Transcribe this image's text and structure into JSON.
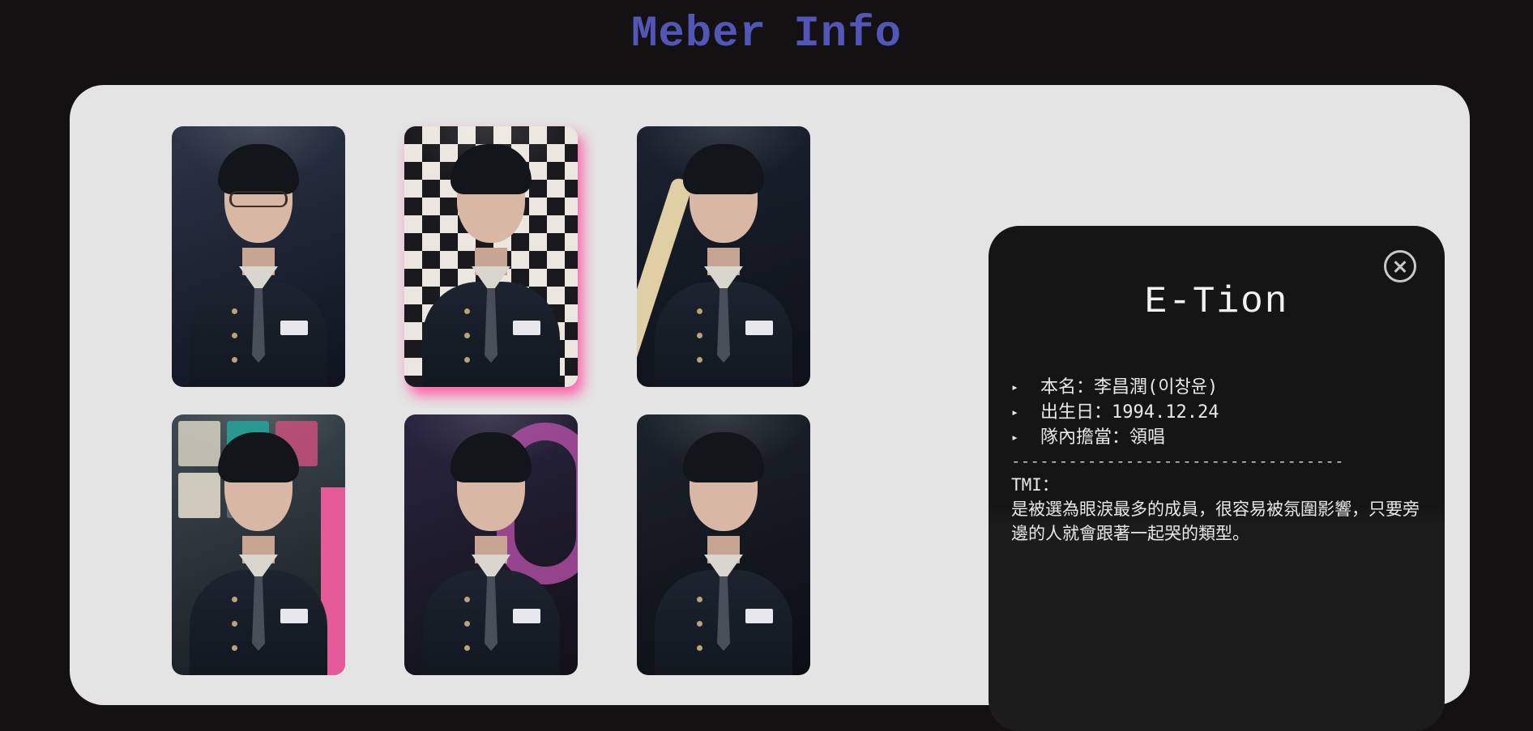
{
  "page": {
    "title": "Meber Info"
  },
  "members": [
    {
      "card_label": "member-photo-1",
      "palette": {
        "bg1": "#2c3446",
        "bg2": "#0f1320",
        "accent": "#7d8aa0"
      },
      "glasses": true
    },
    {
      "card_label": "member-photo-2",
      "palette": {
        "bg1": "#e6e2dc",
        "bg2": "#1b1b1f",
        "accent": "#ff4fa0"
      },
      "checker": true,
      "glow": "#ff5ea8"
    },
    {
      "card_label": "member-photo-3",
      "palette": {
        "bg1": "#1b2230",
        "bg2": "#0d1118",
        "accent": "#e0cfa4"
      },
      "guitar": true
    },
    {
      "card_label": "member-photo-4",
      "palette": {
        "bg1": "#3e4a52",
        "bg2": "#151a1f",
        "accent": "#23a69a"
      },
      "stickers": true
    },
    {
      "card_label": "member-photo-5",
      "palette": {
        "bg1": "#2a2540",
        "bg2": "#121018",
        "accent": "#b450a6"
      },
      "graffiti": true
    },
    {
      "card_label": "member-photo-6",
      "palette": {
        "bg1": "#1c222c",
        "bg2": "#0b0e14",
        "accent": "#8a93a6"
      }
    }
  ],
  "detail": {
    "name": "E-Tion",
    "facts": [
      {
        "bullet": "▸",
        "text": "本名：李昌潤(이창윤)"
      },
      {
        "bullet": "▸",
        "text": "出生日：1994.12.24"
      },
      {
        "bullet": "▸",
        "text": "隊內擔當：領唱"
      }
    ],
    "divider": "-----------------------------------",
    "tmi_label": "TMI：",
    "tmi_text": "是被選為眼淚最多的成員，很容易被氛圍影響，只要旁邊的人就會跟著一起哭的類型。"
  },
  "colors": {
    "page_bg": "#141112",
    "title": "#5256b8",
    "panel_bg": "#e4e4e4",
    "info_bg": "#161516",
    "info_text": "#e8e8e8"
  }
}
